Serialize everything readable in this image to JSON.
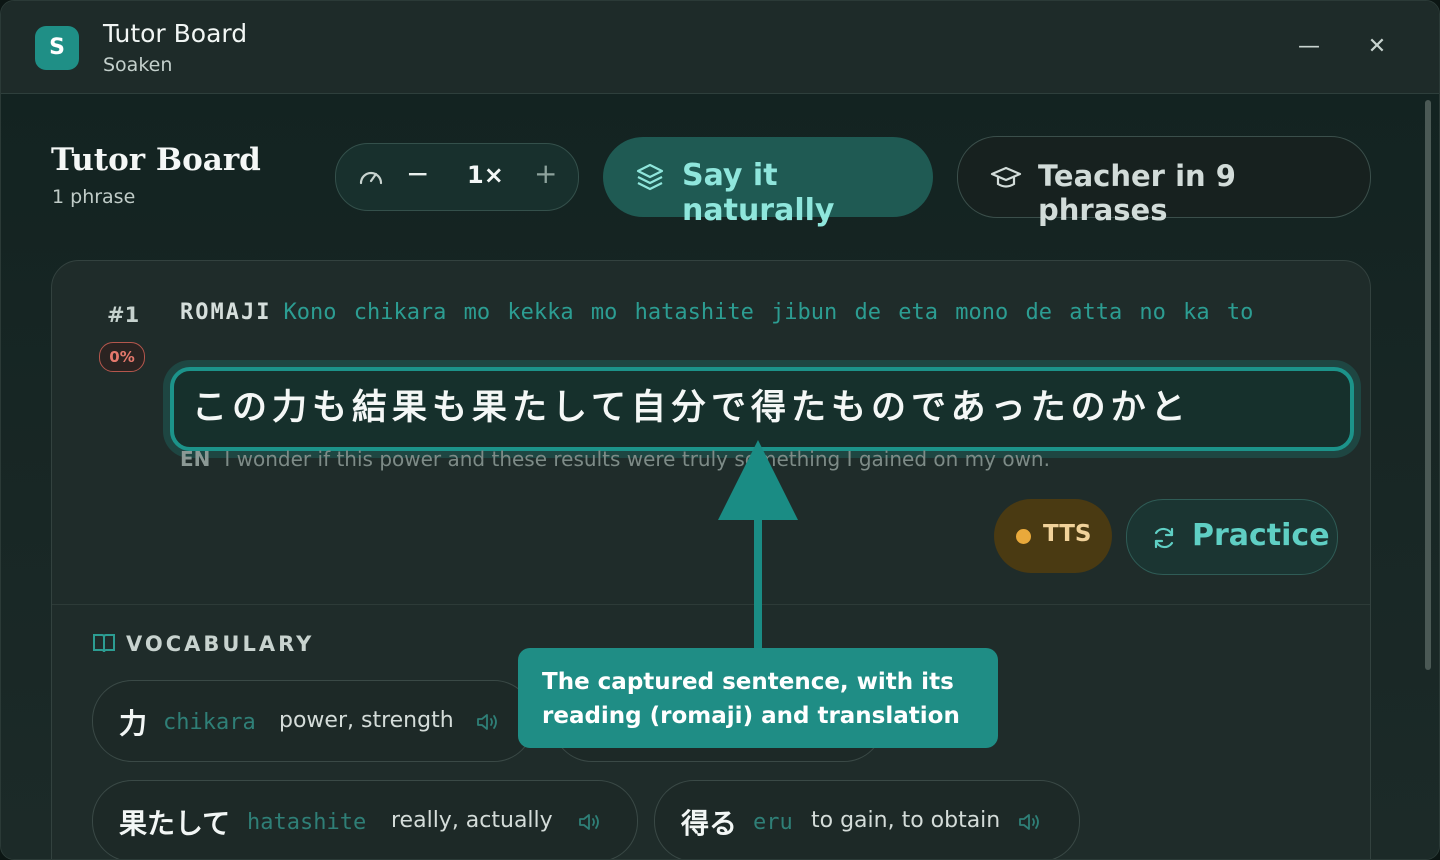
{
  "window": {
    "title": "Tutor Board",
    "subtitle": "Soaken"
  },
  "header": {
    "title": "Tutor Board",
    "count": "1 phrase",
    "speed": {
      "value": "1×",
      "minus": "−",
      "plus": "+"
    },
    "say_naturally_label": "Say it naturally",
    "teacher_label": "Teacher in 9 phrases"
  },
  "phrase": {
    "number": "#1",
    "progress": "0%",
    "romaji_tag": "ROMAJI",
    "romaji": "Kono chikara mo kekka mo hatashite jibun de eta mono de atta no ka to",
    "sentence": "この力も結果も果たして自分で得たものであったのかと",
    "en_tag": "EN",
    "translation": "I wonder if this power and these results were truly something I gained on my own.",
    "tts_label": "TTS",
    "practice_label": "Practice"
  },
  "vocabulary": {
    "title": "VOCABULARY",
    "items": [
      {
        "term": "力",
        "reading": "chikara",
        "meaning": "power, strength"
      },
      {
        "term": "果たして",
        "reading": "hatashite",
        "meaning": "really, actually"
      },
      {
        "term": "得る",
        "reading": "eru",
        "meaning": "to gain, to obtain"
      }
    ]
  },
  "annotation": {
    "text": "The captured sentence, with its reading (romaji) and translation"
  },
  "colors": {
    "accent": "#1f8d85",
    "tts": "#e9a93b",
    "background": "#1b2826"
  }
}
